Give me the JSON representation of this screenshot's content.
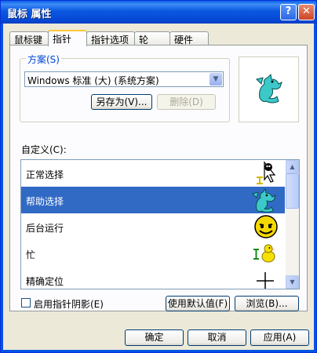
{
  "window": {
    "title": "鼠标 属性",
    "help_glyph": "?",
    "close_glyph": "✕"
  },
  "tabs": [
    {
      "label": "鼠标键",
      "active": false
    },
    {
      "label": "指针",
      "active": true
    },
    {
      "label": "指针选项",
      "active": false
    },
    {
      "label": "轮",
      "active": false
    },
    {
      "label": "硬件",
      "active": false
    }
  ],
  "scheme": {
    "group_label": "方案(S)",
    "selected_value": "Windows 标准 (大) (系统方案)",
    "save_as_label": "另存为(V)...",
    "delete_label": "删除(D)"
  },
  "customize": {
    "label": "自定义(C):",
    "items": [
      {
        "label": "正常选择",
        "icon": "normal-select-cat-icon",
        "selected": false
      },
      {
        "label": "帮助选择",
        "icon": "help-select-dragon-icon",
        "selected": true
      },
      {
        "label": "后台运行",
        "icon": "working-smiley-icon",
        "selected": false
      },
      {
        "label": "忙",
        "icon": "busy-chick-icon",
        "selected": false
      },
      {
        "label": "精确定位",
        "icon": "crosshair-icon",
        "selected": false
      }
    ]
  },
  "shadow": {
    "label": "启用指针阴影(E)",
    "checked": false
  },
  "buttons": {
    "use_default": "使用默认值(F)",
    "browse": "浏览(B)...",
    "ok": "确定",
    "cancel": "取消",
    "apply": "应用(A)"
  },
  "colors": {
    "selection": "#316ac5",
    "titlebar": "#0054e3",
    "dialog_bg": "#ece9d8"
  }
}
